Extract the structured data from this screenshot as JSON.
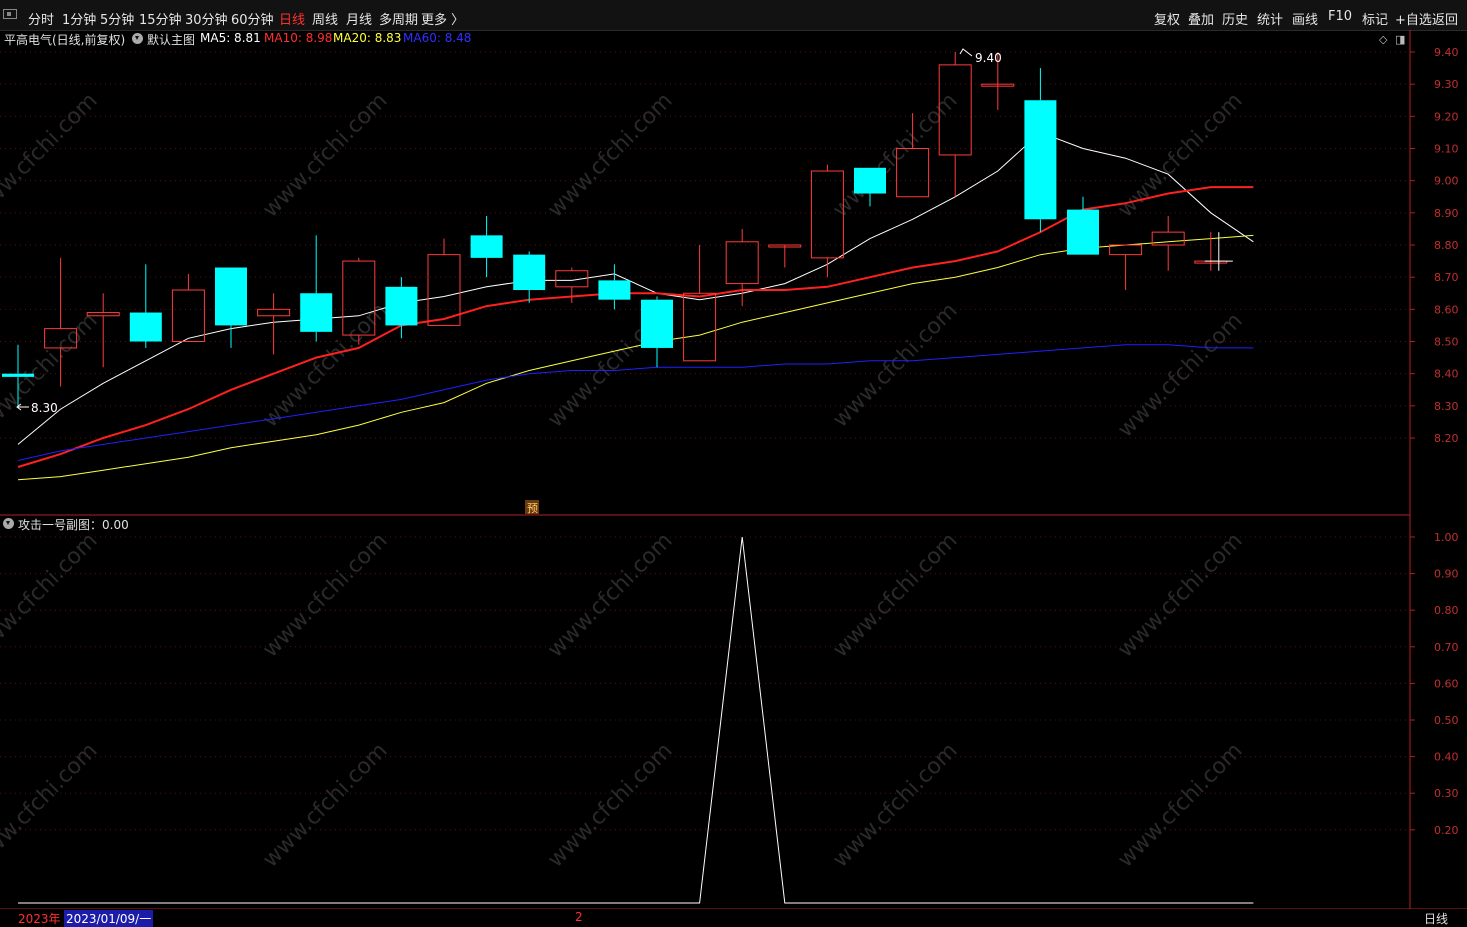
{
  "toolbar": {
    "left_items": [
      "分时",
      "1分钟",
      "5分钟",
      "15分钟",
      "30分钟",
      "60分钟",
      "日线",
      "周线",
      "月线",
      "多周期",
      "更多 〉"
    ],
    "active_index": 6,
    "right_items": [
      "复权",
      "叠加",
      "历史",
      "统计",
      "画线",
      "F10",
      "标记",
      "+自选",
      "返回"
    ]
  },
  "main_header": {
    "stock": "平高电气(日线,前复权)",
    "template": "默认主图",
    "ma5": "MA5: 8.81",
    "ma10": "MA10: 8.98",
    "ma20": "MA20: 8.83",
    "ma60": "MA60: 8.48"
  },
  "sub_header": {
    "title": "攻击一号副图：0.00"
  },
  "annotations": {
    "high_label": "9.40",
    "low_label": "8.30",
    "forecast_mark": "预"
  },
  "watermark": "www.cfchi.com",
  "bottom_bar": {
    "year": "2023年",
    "date": "2023/01/09/一",
    "mid_mark": "2",
    "period": "日线"
  },
  "colors": {
    "up": "#ff3b3b",
    "down": "#00ffff",
    "ma5": "#ffffff",
    "ma10": "#ff2020",
    "ma20": "#ffff40",
    "ma60": "#2020ff",
    "axis": "#b02020"
  },
  "chart_data": [
    {
      "type": "candlestick",
      "title": "平高电气(日线,前复权)",
      "y_ticks": [
        "9.40",
        "9.30",
        "9.20",
        "9.10",
        "9.00",
        "8.90",
        "8.80",
        "8.70",
        "8.60",
        "8.50",
        "8.40",
        "8.30",
        "8.20"
      ],
      "ylim": [
        8.08,
        9.46
      ],
      "candles": [
        {
          "o": 8.4,
          "h": 8.49,
          "l": 8.3,
          "c": 8.39
        },
        {
          "o": 8.48,
          "h": 8.76,
          "l": 8.36,
          "c": 8.54
        },
        {
          "o": 8.58,
          "h": 8.65,
          "l": 8.42,
          "c": 8.59
        },
        {
          "o": 8.59,
          "h": 8.74,
          "l": 8.48,
          "c": 8.5
        },
        {
          "o": 8.5,
          "h": 8.71,
          "l": 8.5,
          "c": 8.66
        },
        {
          "o": 8.73,
          "h": 8.73,
          "l": 8.48,
          "c": 8.55
        },
        {
          "o": 8.58,
          "h": 8.65,
          "l": 8.46,
          "c": 8.6
        },
        {
          "o": 8.65,
          "h": 8.83,
          "l": 8.5,
          "c": 8.53
        },
        {
          "o": 8.52,
          "h": 8.76,
          "l": 8.49,
          "c": 8.75
        },
        {
          "o": 8.67,
          "h": 8.7,
          "l": 8.51,
          "c": 8.55
        },
        {
          "o": 8.55,
          "h": 8.82,
          "l": 8.55,
          "c": 8.77
        },
        {
          "o": 8.83,
          "h": 8.89,
          "l": 8.7,
          "c": 8.76
        },
        {
          "o": 8.77,
          "h": 8.78,
          "l": 8.62,
          "c": 8.66
        },
        {
          "o": 8.67,
          "h": 8.73,
          "l": 8.62,
          "c": 8.72
        },
        {
          "o": 8.69,
          "h": 8.74,
          "l": 8.6,
          "c": 8.63
        },
        {
          "o": 8.63,
          "h": 8.64,
          "l": 8.42,
          "c": 8.48
        },
        {
          "o": 8.44,
          "h": 8.8,
          "l": 8.44,
          "c": 8.65
        },
        {
          "o": 8.68,
          "h": 8.85,
          "l": 8.61,
          "c": 8.81
        },
        {
          "o": 8.8,
          "h": 8.8,
          "l": 8.73,
          "c": 8.8
        },
        {
          "o": 8.76,
          "h": 9.05,
          "l": 8.7,
          "c": 9.03
        },
        {
          "o": 9.04,
          "h": 9.04,
          "l": 8.92,
          "c": 8.96
        },
        {
          "o": 8.95,
          "h": 9.21,
          "l": 8.95,
          "c": 9.1
        },
        {
          "o": 9.08,
          "h": 9.4,
          "l": 8.95,
          "c": 9.36
        },
        {
          "o": 9.3,
          "h": 9.4,
          "l": 9.22,
          "c": 9.3
        },
        {
          "o": 9.25,
          "h": 9.35,
          "l": 8.84,
          "c": 8.88
        },
        {
          "o": 8.91,
          "h": 8.95,
          "l": 8.77,
          "c": 8.77
        },
        {
          "o": 8.77,
          "h": 8.8,
          "l": 8.66,
          "c": 8.8
        },
        {
          "o": 8.8,
          "h": 8.89,
          "l": 8.72,
          "c": 8.84
        },
        {
          "o": 8.75,
          "h": 8.84,
          "l": 8.72,
          "c": 8.75
        }
      ],
      "series": [
        {
          "name": "MA5",
          "values": [
            8.18,
            8.29,
            8.37,
            8.44,
            8.51,
            8.54,
            8.56,
            8.57,
            8.58,
            8.62,
            8.64,
            8.67,
            8.69,
            8.69,
            8.71,
            8.65,
            8.63,
            8.65,
            8.68,
            8.74,
            8.82,
            8.88,
            8.95,
            9.03,
            9.15,
            9.1,
            9.07,
            9.02,
            8.9,
            8.81
          ]
        },
        {
          "name": "MA10",
          "values": [
            8.11,
            8.15,
            8.2,
            8.24,
            8.29,
            8.35,
            8.4,
            8.45,
            8.48,
            8.55,
            8.57,
            8.61,
            8.63,
            8.64,
            8.65,
            8.65,
            8.64,
            8.66,
            8.66,
            8.67,
            8.7,
            8.73,
            8.75,
            8.78,
            8.84,
            8.91,
            8.93,
            8.96,
            8.98,
            8.98
          ]
        },
        {
          "name": "MA20",
          "values": [
            8.07,
            8.08,
            8.1,
            8.12,
            8.14,
            8.17,
            8.19,
            8.21,
            8.24,
            8.28,
            8.31,
            8.37,
            8.41,
            8.44,
            8.47,
            8.5,
            8.52,
            8.56,
            8.59,
            8.62,
            8.65,
            8.68,
            8.7,
            8.73,
            8.77,
            8.79,
            8.8,
            8.81,
            8.82,
            8.83
          ]
        },
        {
          "name": "MA60",
          "values": [
            8.13,
            8.16,
            8.18,
            8.2,
            8.22,
            8.24,
            8.26,
            8.28,
            8.3,
            8.32,
            8.35,
            8.38,
            8.4,
            8.41,
            8.41,
            8.42,
            8.42,
            8.42,
            8.43,
            8.43,
            8.44,
            8.44,
            8.45,
            8.46,
            8.47,
            8.48,
            8.49,
            8.49,
            8.48,
            8.48
          ]
        }
      ]
    },
    {
      "type": "line",
      "title": "攻击一号副图：0.00",
      "y_ticks": [
        "1.00",
        "0.90",
        "0.80",
        "0.70",
        "0.60",
        "0.50",
        "0.40",
        "0.30",
        "0.20"
      ],
      "ylim": [
        0,
        1.0
      ],
      "series": [
        {
          "values": [
            0,
            0,
            0,
            0,
            0,
            0,
            0,
            0,
            0,
            0,
            0,
            0,
            0,
            0,
            0,
            0,
            0,
            1,
            0,
            0,
            0,
            0,
            0,
            0,
            0,
            0,
            0,
            0,
            0,
            0
          ]
        }
      ]
    }
  ]
}
